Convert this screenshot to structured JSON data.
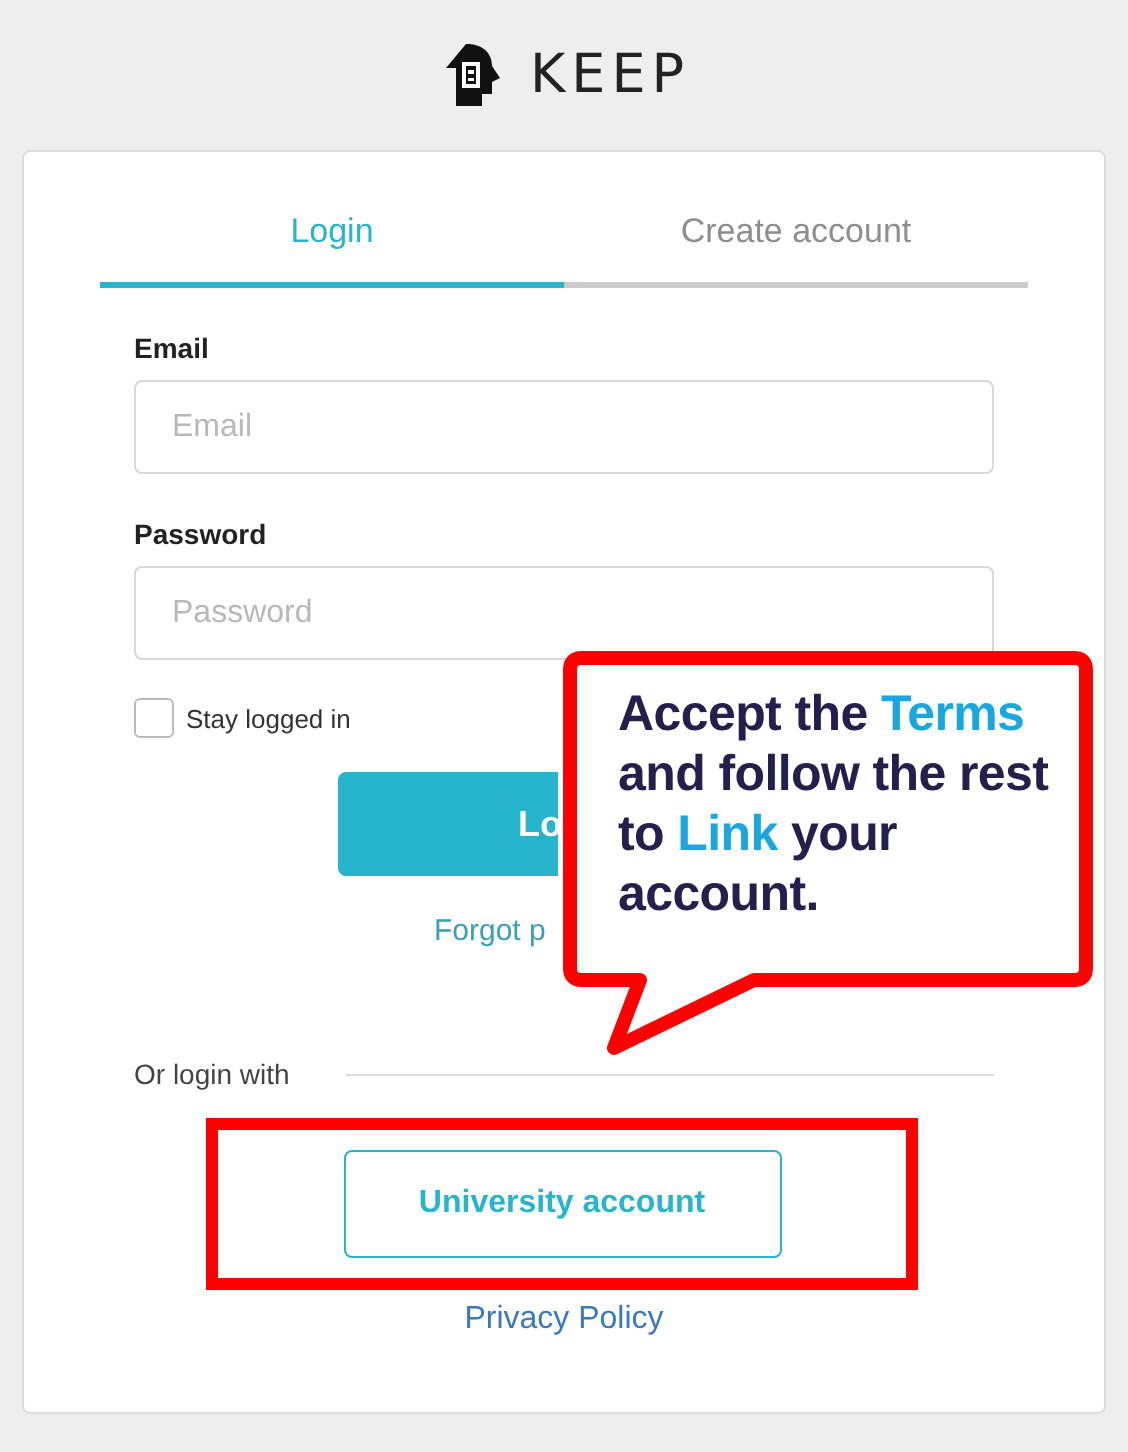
{
  "logo": {
    "text": "KEEP"
  },
  "tabs": [
    {
      "label": "Login",
      "selected": true
    },
    {
      "label": "Create account",
      "selected": false
    }
  ],
  "fields": [
    {
      "label": "Email",
      "placeholder": "Email"
    },
    {
      "label": "Password",
      "placeholder": "Password"
    }
  ],
  "stay_logged_in": {
    "label": "Stay logged in",
    "checked": false
  },
  "login_button": {
    "label": "Lo"
  },
  "forgot_link": {
    "label": "Forgot p"
  },
  "alt_login": {
    "label": "Or login with",
    "buttons": [
      {
        "label": "University account"
      }
    ]
  },
  "privacy_link": {
    "label": "Privacy Policy"
  },
  "callout": {
    "text": "Accept the **Terms** and follow the rest to **Link** your account."
  }
}
